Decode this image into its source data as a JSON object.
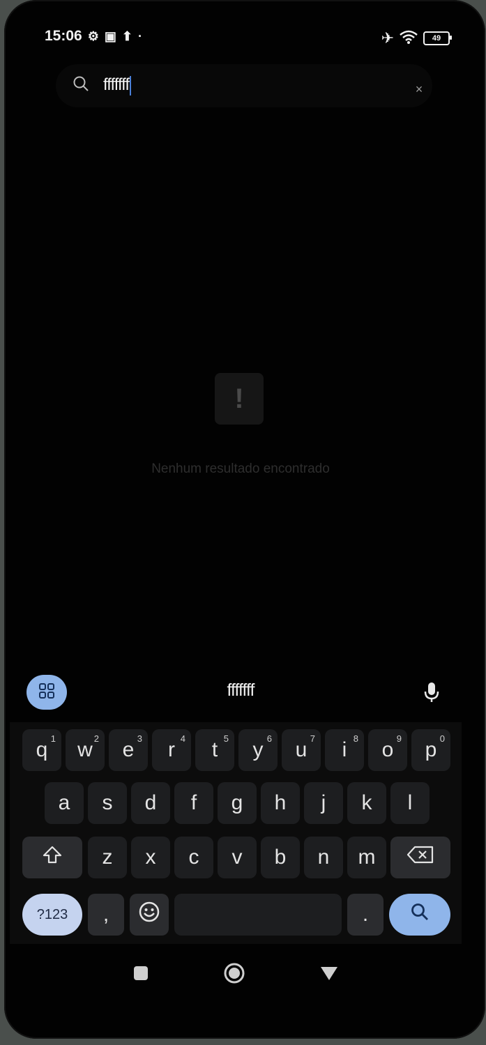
{
  "status_bar": {
    "time": "15:06",
    "battery": "49"
  },
  "search": {
    "query": "fffffff",
    "clear_glyph": "×"
  },
  "empty_state": {
    "icon_glyph": "!",
    "message": "Nenhum resultado encontrado"
  },
  "suggestion_strip": {
    "suggestion": "fffffff"
  },
  "keyboard": {
    "row1": [
      {
        "key": "q",
        "hint": "1"
      },
      {
        "key": "w",
        "hint": "2"
      },
      {
        "key": "e",
        "hint": "3"
      },
      {
        "key": "r",
        "hint": "4"
      },
      {
        "key": "t",
        "hint": "5"
      },
      {
        "key": "y",
        "hint": "6"
      },
      {
        "key": "u",
        "hint": "7"
      },
      {
        "key": "i",
        "hint": "8"
      },
      {
        "key": "o",
        "hint": "9"
      },
      {
        "key": "p",
        "hint": "0"
      }
    ],
    "row2": [
      "a",
      "s",
      "d",
      "f",
      "g",
      "h",
      "j",
      "k",
      "l"
    ],
    "row3": [
      "z",
      "x",
      "c",
      "v",
      "b",
      "n",
      "m"
    ],
    "symbols_label": "?123",
    "comma": ",",
    "period": "."
  },
  "icons": {
    "search": "search-icon",
    "clear": "close-icon",
    "apps": "grid-icon",
    "mic": "microphone-icon",
    "shift": "shift-icon",
    "backspace": "backspace-icon",
    "emoji": "emoji-icon",
    "enter": "search-icon",
    "recent": "square-icon",
    "home": "circle-icon",
    "back": "triangle-icon"
  },
  "colors": {
    "accent": "#8fb5ea",
    "background": "#020202",
    "key": "#1d1e20"
  }
}
